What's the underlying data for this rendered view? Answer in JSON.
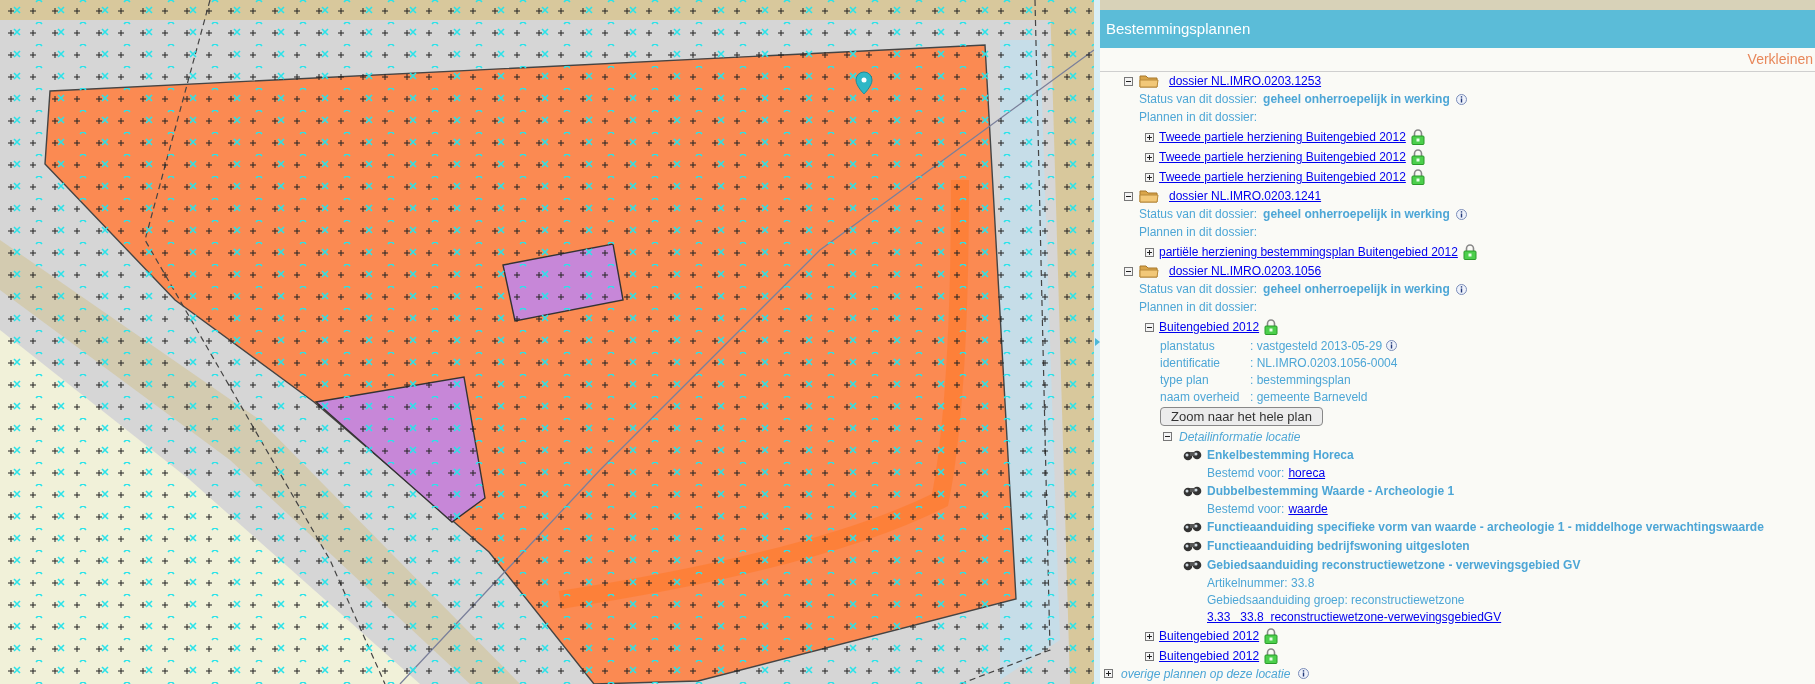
{
  "panel": {
    "title": "Bestemmingsplannen",
    "collapse_link": "Verkleinen",
    "dossiers": [
      {
        "name": "dossier NL.IMRO.0203.1253",
        "expanded": true,
        "status_label": "Status van dit dossier:",
        "status_value": "geheel onherroepelijk in werking",
        "plans_label": "Plannen in dit dossier:",
        "plans": [
          {
            "name": "Tweede partiele herziening Buitengebied 2012",
            "expanded": false
          },
          {
            "name": "Tweede partiele herziening Buitengebied 2012",
            "expanded": false
          },
          {
            "name": "Tweede partiele herziening Buitengebied 2012",
            "expanded": false
          }
        ]
      },
      {
        "name": "dossier NL.IMRO.0203.1241",
        "expanded": true,
        "status_label": "Status van dit dossier:",
        "status_value": "geheel onherroepelijk in werking",
        "plans_label": "Plannen in dit dossier:",
        "plans": [
          {
            "name": "partiële herziening bestemmingsplan Buitengebied 2012",
            "expanded": false
          }
        ]
      },
      {
        "name": "dossier NL.IMRO.0203.1056",
        "expanded": true,
        "status_label": "Status van dit dossier:",
        "status_value": "geheel onherroepelijk in werking",
        "plans_label": "Plannen in dit dossier:",
        "plans": [
          {
            "name": "Buitengebied 2012",
            "expanded": true,
            "properties": [
              {
                "label": "planstatus",
                "value": ": vastgesteld 2013-05-29",
                "info": true
              },
              {
                "label": "identificatie",
                "value": ": NL.IMRO.0203.1056-0004"
              },
              {
                "label": "type plan",
                "value": ": bestemmingsplan"
              },
              {
                "label": "naam overheid",
                "value": ": gemeente Barneveld"
              }
            ],
            "zoom_button": "Zoom naar het hele plan",
            "detail": {
              "title": "Detailinformatie locatie",
              "expanded": true,
              "items": [
                {
                  "title": "Enkelbestemming Horeca",
                  "lines": [
                    {
                      "kind": "labeled_link",
                      "label": "Bestemd voor:",
                      "link": "horeca"
                    }
                  ]
                },
                {
                  "title": "Dubbelbestemming Waarde - Archeologie 1",
                  "lines": [
                    {
                      "kind": "labeled_link",
                      "label": "Bestemd voor:",
                      "link": "waarde"
                    }
                  ]
                },
                {
                  "title": "Functieaanduiding specifieke vorm van waarde - archeologie 1 - middelhoge verwachtingswaarde"
                },
                {
                  "title": "Functieaanduiding bedrijfswoning uitgesloten"
                },
                {
                  "title": "Gebiedsaanduiding reconstructiewetzone - verwevingsgebied GV",
                  "lines": [
                    {
                      "kind": "text",
                      "text": "Artikelnummer: 33.8"
                    },
                    {
                      "kind": "text",
                      "text": "Gebiedsaanduiding groep: reconstructiewetzone"
                    },
                    {
                      "kind": "link",
                      "link": "3.33   33.8  reconstructiewetzone-verwevingsgebiedGV"
                    }
                  ]
                }
              ]
            }
          },
          {
            "name": "Buitengebied 2012",
            "expanded": false
          },
          {
            "name": "Buitengebied 2012",
            "expanded": false
          }
        ]
      }
    ],
    "other": {
      "label": "overige plannen op deze locatie",
      "expanded": false
    }
  }
}
